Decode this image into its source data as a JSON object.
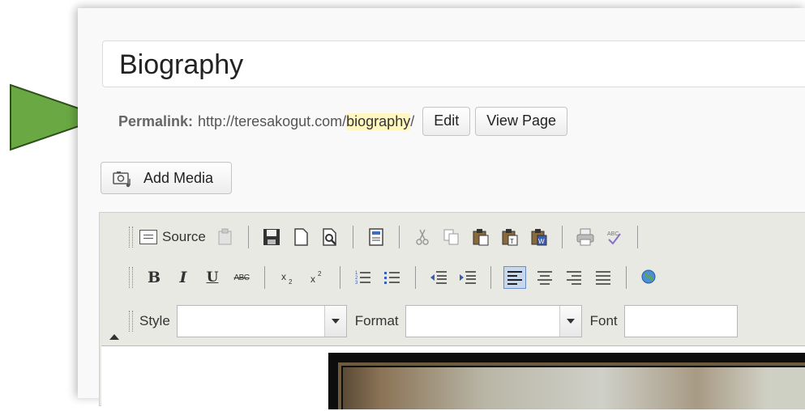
{
  "title": {
    "value": "Biography"
  },
  "permalink": {
    "label": "Permalink:",
    "base_url": "http://teresakogut.com/",
    "slug": "biography",
    "trailing": "/",
    "edit_label": "Edit",
    "view_label": "View Page"
  },
  "media": {
    "add_label": "Add Media"
  },
  "toolbar": {
    "source_label": "Source",
    "style_label": "Style",
    "format_label": "Format",
    "font_label": "Font",
    "style_value": "",
    "format_value": "",
    "font_value": ""
  },
  "colors": {
    "arrow": "#6aa843",
    "slug_highlight": "#fff6c0",
    "toolbar_bg": "#e9e9e4",
    "active_button": "#c7d8ee"
  }
}
